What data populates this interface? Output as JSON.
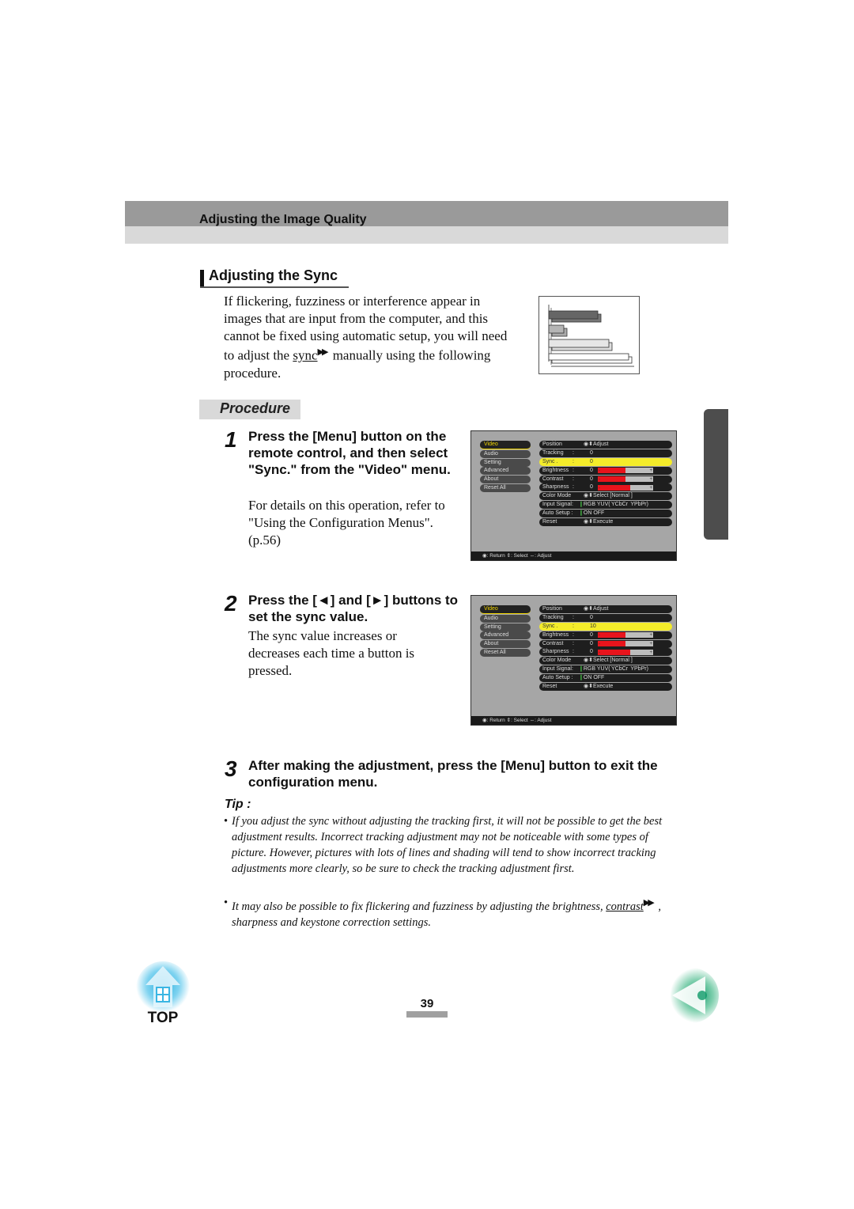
{
  "header": {
    "section_title": "Adjusting the Image Quality"
  },
  "section": {
    "title": "Adjusting the Sync",
    "intro": {
      "text_before": "If flickering, fuzziness or interference appear in images that are input from the computer, and this cannot be fixed using automatic setup, you will need to adjust the ",
      "term": "sync",
      "term_icon": "glossary-link-icon",
      "text_after": " manually using the following procedure."
    }
  },
  "procedure": {
    "label": "Procedure",
    "steps": [
      {
        "number": "1",
        "heading": "Press the [Menu] button on the remote control, and then select \"Sync.\" from the \"Video\" menu.",
        "body": "For details on this operation, refer to \"Using the Configuration Menus\". (p.56)"
      },
      {
        "number": "2",
        "heading": "Press the [◄] and [►] buttons to set the sync value.",
        "body": "The sync value increases or decreases each time a button is pressed."
      },
      {
        "number": "3",
        "heading": "After making the adjustment, press the [Menu] button to exit the configuration menu.",
        "body": ""
      }
    ]
  },
  "osd_menus": [
    {
      "left_menu": [
        "Video",
        "Audio",
        "Setting",
        "Advanced",
        "About",
        "Reset All"
      ],
      "selected_left": "Video",
      "rows": {
        "position": {
          "label": "Position",
          "action": "Adjust"
        },
        "tracking": {
          "label": "Tracking",
          "value": "0"
        },
        "sync": {
          "label": "Sync .",
          "value": "0"
        },
        "brightness": {
          "label": "Brightness",
          "value": "0",
          "level": 0.5
        },
        "contrast": {
          "label": "Contrast",
          "value": "0",
          "level": 0.5
        },
        "sharpness": {
          "label": "Sharpness",
          "value": "0",
          "level": 0.58
        },
        "color_mode": {
          "label": "Color Mode",
          "action": "Select",
          "current": "[Normal       ]"
        },
        "input_signal": {
          "label": "Input Signal:",
          "options": "RGB  YUV( YCbCr  YPbPr)"
        },
        "auto_setup": {
          "label": "Auto Setup :",
          "options": "ON   OFF"
        },
        "reset": {
          "label": "Reset",
          "action": "Execute"
        }
      },
      "footer": {
        "return": ": Return",
        "select": ": Select",
        "adjust": ": Adjust"
      }
    },
    {
      "left_menu": [
        "Video",
        "Audio",
        "Setting",
        "Advanced",
        "About",
        "Reset All"
      ],
      "selected_left": "Video",
      "rows": {
        "position": {
          "label": "Position",
          "action": "Adjust"
        },
        "tracking": {
          "label": "Tracking",
          "value": "0"
        },
        "sync": {
          "label": "Sync .",
          "value": "10"
        },
        "brightness": {
          "label": "Brightness",
          "value": "0",
          "level": 0.5
        },
        "contrast": {
          "label": "Contrast",
          "value": "0",
          "level": 0.5
        },
        "sharpness": {
          "label": "Sharpness",
          "value": "0",
          "level": 0.58
        },
        "color_mode": {
          "label": "Color Mode",
          "action": "Select",
          "current": "[Normal       ]"
        },
        "input_signal": {
          "label": "Input Signal:",
          "options": "RGB  YUV( YCbCr  YPbPr)"
        },
        "auto_setup": {
          "label": "Auto Setup :",
          "options": "ON   OFF"
        },
        "reset": {
          "label": "Reset",
          "action": "Execute"
        }
      },
      "footer": {
        "return": ": Return",
        "select": ": Select",
        "adjust": ": Adjust"
      }
    }
  ],
  "tip": {
    "label": "Tip :",
    "items": [
      "If you adjust the sync without adjusting the tracking first, it will not be possible to get the best adjustment results. Incorrect tracking adjustment may not be noticeable with some types of picture. However, pictures with lots of lines and shading will tend to show incorrect tracking adjustments more clearly, so be sure to check the tracking adjustment first.",
      {
        "before": "It may also be possible to fix flickering and fuzziness by adjusting the brightness, ",
        "term": "contrast",
        "after": " , sharpness and keystone correction settings."
      }
    ],
    "bullet": "•"
  },
  "footer": {
    "top_label": "TOP",
    "page_number": "39"
  },
  "colors": {
    "header_dark": "#9a9a9a",
    "header_light": "#d9d9d9",
    "osd_highlight": "#f4ec2a",
    "osd_bar_fill": "#e8141c",
    "top_icon": "#4cc3e8",
    "back_icon": "#1ea070"
  }
}
